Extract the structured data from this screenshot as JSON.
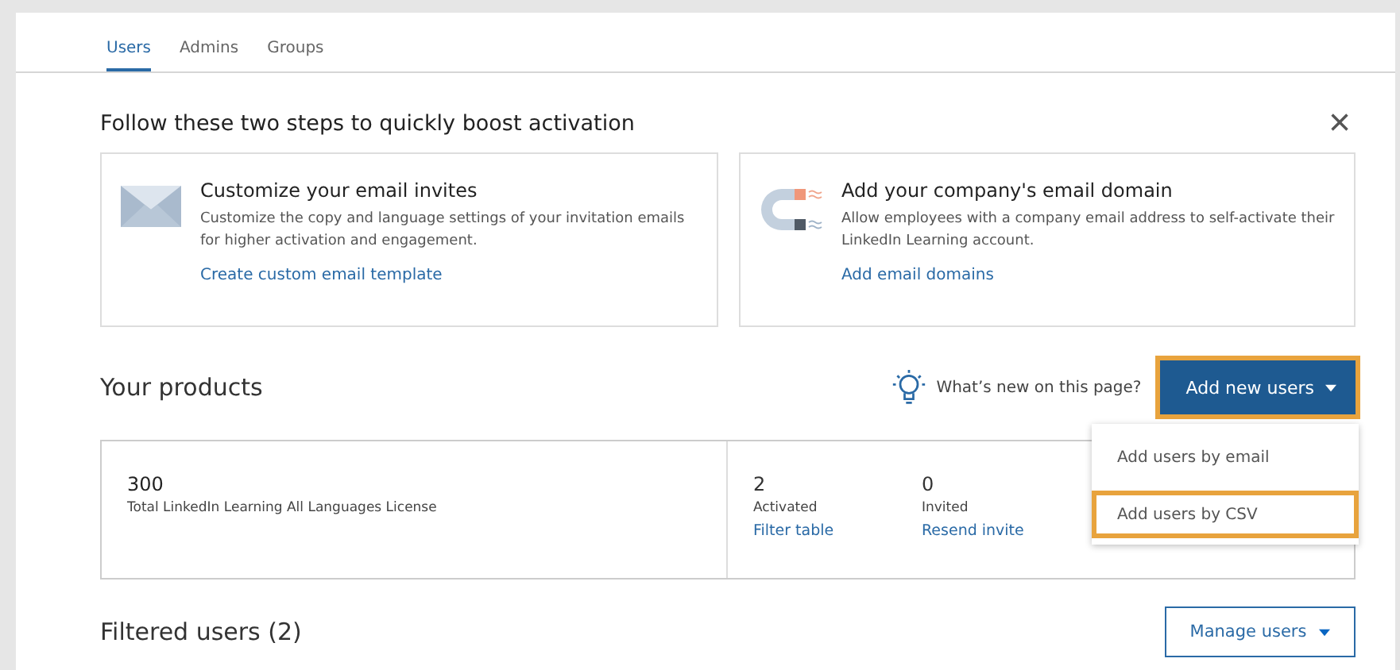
{
  "tabs": [
    {
      "label": "Users",
      "selected": true
    },
    {
      "label": "Admins",
      "selected": false
    },
    {
      "label": "Groups",
      "selected": false
    }
  ],
  "activation": {
    "title": "Follow these two steps to quickly boost activation",
    "close": "×",
    "steps": [
      {
        "kind": "envelope",
        "title": "Customize your email invites",
        "text": "Customize the copy and language settings of your invitation emails for higher activation and engagement.",
        "link": "Create custom email template"
      },
      {
        "kind": "magnet",
        "title": "Add your company's email domain",
        "text": "Allow employees with a company email address to self-activate their LinkedIn Learning account.",
        "link": "Add email domains"
      }
    ]
  },
  "products": {
    "title": "Your products",
    "whats_new": "What’s new on this page?",
    "add_button": {
      "label": "Add new users",
      "highlighted": true
    },
    "menu": [
      {
        "label": "Add users by email",
        "highlighted": false
      },
      {
        "label": "Add users by CSV",
        "highlighted": true
      }
    ],
    "license": {
      "count": "300",
      "name": "Total LinkedIn Learning All Languages License"
    },
    "stats": [
      {
        "value": "2",
        "label": "Activated",
        "link": "Filter table"
      },
      {
        "value": "0",
        "label": "Invited",
        "link": "Resend invite"
      }
    ]
  },
  "filtered": {
    "title": "Filtered users (2)",
    "manage_button": "Manage users"
  }
}
